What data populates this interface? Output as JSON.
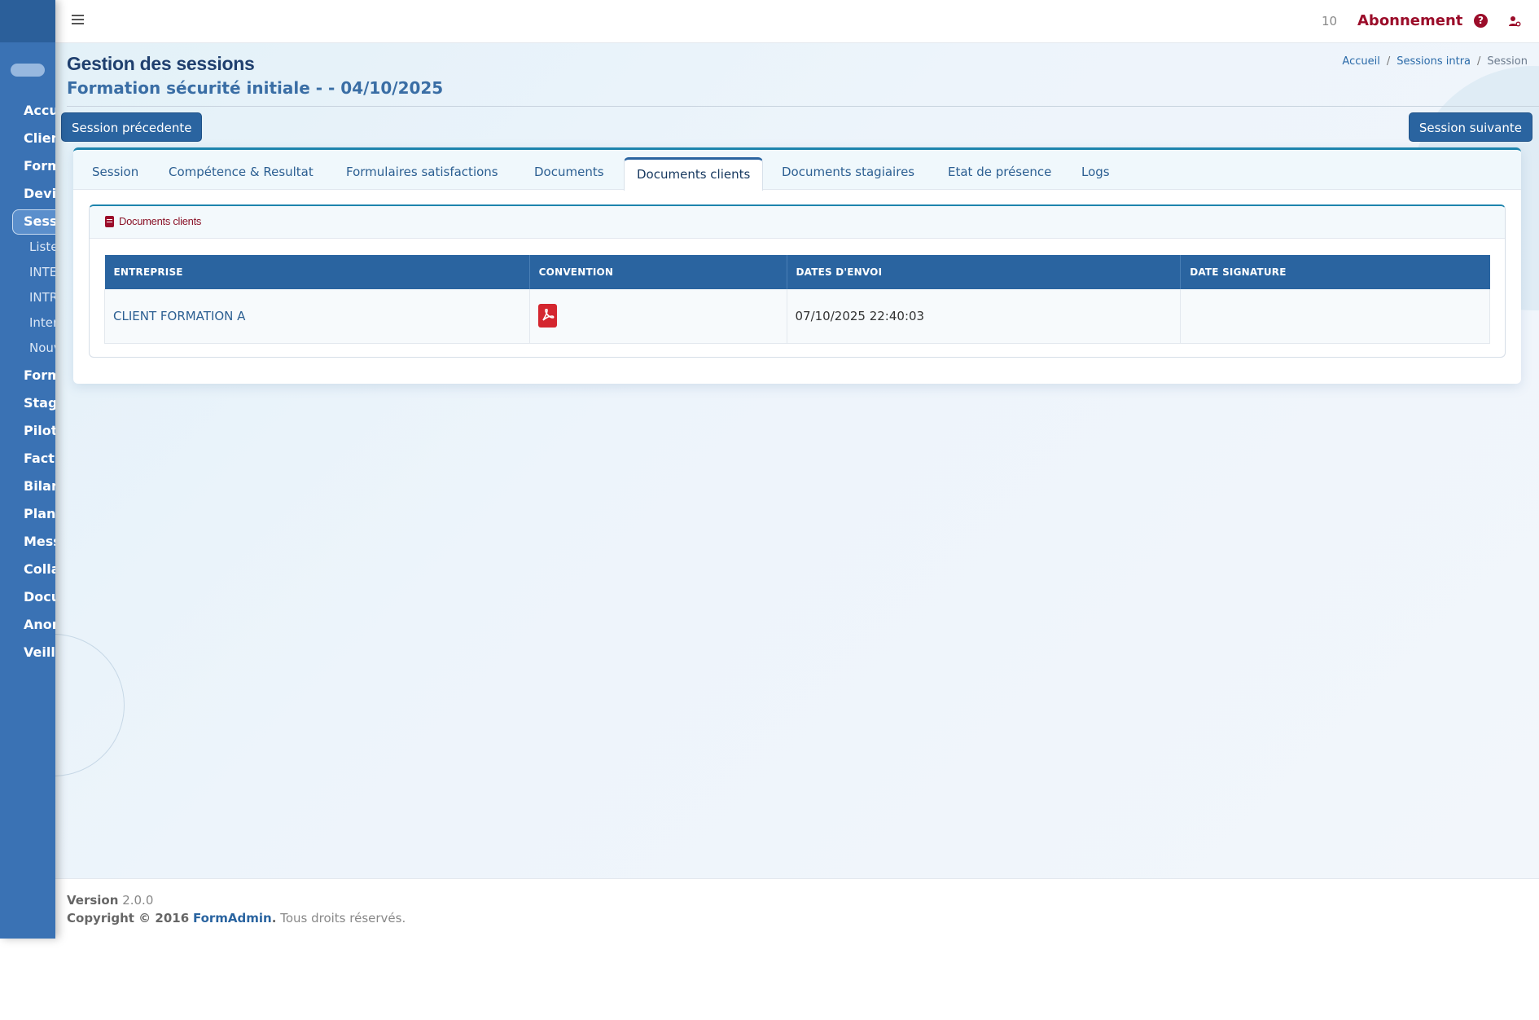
{
  "sidebar": {
    "items": [
      {
        "label": "Accueil"
      },
      {
        "label": "Clients"
      },
      {
        "label": "Formations"
      },
      {
        "label": "Devis"
      },
      {
        "label": "Sessions"
      },
      {
        "label": "Formateurs"
      },
      {
        "label": "Stagiaires"
      },
      {
        "label": "Pilotage"
      },
      {
        "label": "Facturation"
      },
      {
        "label": "Bilan"
      },
      {
        "label": "Planning"
      },
      {
        "label": "Messagerie"
      },
      {
        "label": "Collaborateurs"
      },
      {
        "label": "Documents"
      },
      {
        "label": "Anomalies"
      },
      {
        "label": "Veille"
      }
    ],
    "subitems": [
      {
        "label": "Liste"
      },
      {
        "label": "INTER"
      },
      {
        "label": "INTRA"
      },
      {
        "label": "Inter"
      },
      {
        "label": "Nouvelle"
      }
    ]
  },
  "topbar": {
    "count": "10",
    "subscription_label": "Abonnement",
    "help_icon": "question-circle-icon",
    "user_icon": "user-settings-icon"
  },
  "page": {
    "title": "Gestion des sessions",
    "subtitle": "Formation sécurité initiale - - 04/10/2025",
    "breadcrumb": [
      "Accueil",
      "Sessions intra",
      "Session"
    ],
    "prev_label": "Session précedente",
    "next_label": "Session suivante"
  },
  "tabs": [
    {
      "label": "Session"
    },
    {
      "label": "Compétence & Resultat"
    },
    {
      "label": "Formulaires satisfactions"
    },
    {
      "label": "Documents"
    },
    {
      "label": "Documents clients",
      "active": true
    },
    {
      "label": "Documents stagiaires"
    },
    {
      "label": "Etat de présence"
    },
    {
      "label": "Logs"
    }
  ],
  "panel": {
    "title": "Documents clients",
    "icon": "document-icon",
    "columns": [
      "Entreprise",
      "Convention",
      "Dates d'envoi",
      "Date signature"
    ],
    "rows": [
      {
        "entreprise": "CLIENT FORMATION A",
        "convention_icon": "pdf-file-icon",
        "date_envoi": "07/10/2025 22:40:03",
        "date_signature": ""
      }
    ]
  },
  "footer": {
    "version_label": "Version",
    "version": "2.0.0",
    "copyright_prefix": "Copyright © 2016",
    "brand": "FormAdmin",
    "rights": "Tous droits réservés."
  },
  "colors": {
    "primary": "#2a64a0",
    "sidebar": "#3a72b4",
    "accent_red": "#9b0d2a",
    "pdf_red": "#d4262f"
  }
}
